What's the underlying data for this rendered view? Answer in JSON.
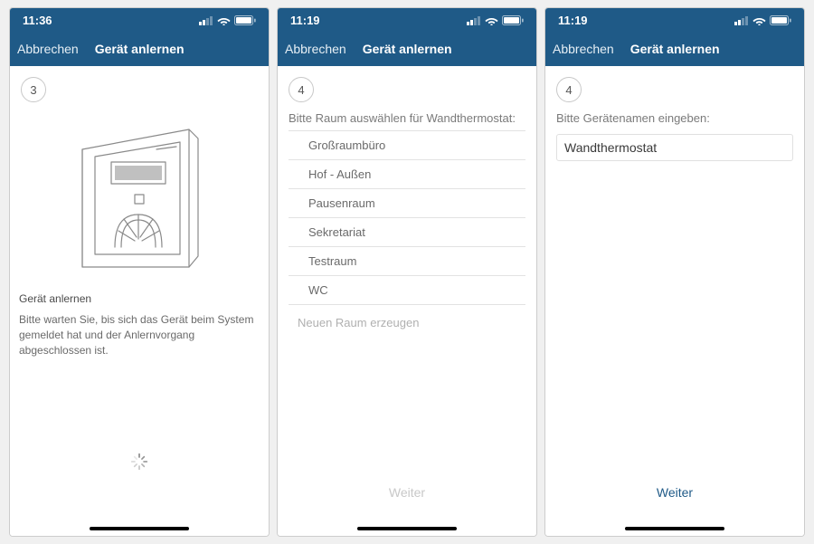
{
  "common": {
    "cancel_label": "Abbrechen",
    "title": "Gerät anlernen",
    "next_label": "Weiter"
  },
  "screen1": {
    "time": "11:36",
    "step": "3",
    "msg_title": "Gerät anlernen",
    "msg_text": "Bitte warten Sie, bis sich das Gerät beim System gemeldet hat und der Anlernvorgang abgeschlossen ist."
  },
  "screen2": {
    "time": "11:19",
    "step": "4",
    "prompt": "Bitte Raum auswählen für Wandthermostat:",
    "rooms": [
      "Großraumbüro",
      "Hof - Außen",
      "Pausenraum",
      "Sekretariat",
      "Testraum",
      "WC"
    ],
    "create_room": "Neuen Raum erzeugen"
  },
  "screen3": {
    "time": "11:19",
    "step": "4",
    "prompt": "Bitte Gerätenamen eingeben:",
    "input_value": "Wandthermostat"
  }
}
